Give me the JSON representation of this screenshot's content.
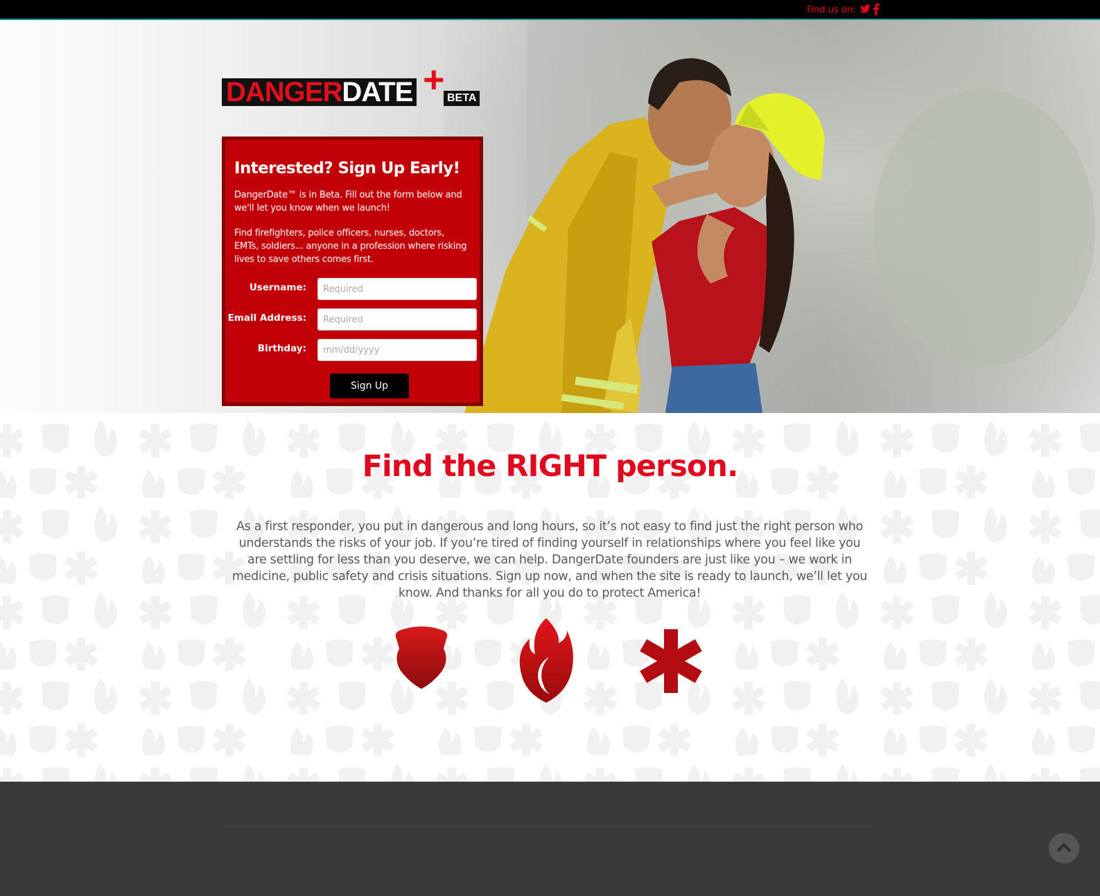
{
  "topbar": {
    "find_label": "Find us on:",
    "icons": [
      "twitter-icon",
      "facebook-icon"
    ],
    "accent": "#e8001c"
  },
  "brand": {
    "danger": "DANGER",
    "date": "DATE",
    "plus": "+",
    "beta": "BETA",
    "red": "#e10e1c"
  },
  "signup": {
    "heading": "Interested? Sign Up Early!",
    "intro": "DangerDate™ is in Beta. Fill out the form below and we'll let you know when we launch!",
    "description": "Find firefighters, police officers, nurses, doctors, EMTs, soldiers... anyone in a profession where risking lives to save others comes first.",
    "fields": [
      {
        "label": "Username:",
        "placeholder": "Required",
        "value": ""
      },
      {
        "label": "Email Address:",
        "placeholder": "Required",
        "value": ""
      },
      {
        "label": "Birthday:",
        "placeholder": "mm/dd/yyyy",
        "value": ""
      }
    ],
    "button": "Sign Up",
    "panel_color": "#c20007",
    "border_color": "#830005"
  },
  "main": {
    "heading": "Find the RIGHT person.",
    "body": "As a first responder, you put in dangerous and long hours, so it’s not easy to find just the right person who understands the risks of your job. If you’re tired of finding yourself in relationships where you feel like you are settling for less than you deserve, we can help. DangerDate founders are just like you – we work in medicine, public safety and crisis situations. Sign up now, and when the site is ready to launch, we’ll let you know. And thanks for all you do to protect America!",
    "icons": [
      "police-badge-icon",
      "fire-icon",
      "star-of-life-icon"
    ],
    "heading_color": "#e00a1e"
  },
  "footer": {
    "back_to_top_icon": "chevron-up-icon",
    "color": "#3a3a3a"
  }
}
